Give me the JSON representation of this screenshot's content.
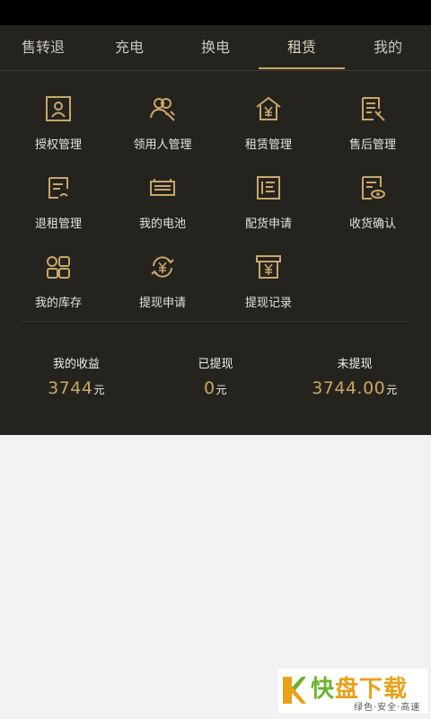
{
  "tabs": [
    {
      "label": "售转退",
      "active": false
    },
    {
      "label": "充电",
      "active": false
    },
    {
      "label": "换电",
      "active": false
    },
    {
      "label": "租赁",
      "active": true
    },
    {
      "label": "我的",
      "active": false
    }
  ],
  "menu": [
    {
      "label": "授权管理",
      "icon": "portrait-frame-icon"
    },
    {
      "label": "领用人管理",
      "icon": "users-wrench-icon"
    },
    {
      "label": "租赁管理",
      "icon": "house-yen-icon"
    },
    {
      "label": "售后管理",
      "icon": "document-wrench-icon"
    },
    {
      "label": "退租管理",
      "icon": "note-pen-icon"
    },
    {
      "label": "我的电池",
      "icon": "battery-icon"
    },
    {
      "label": "配货申请",
      "icon": "document-list-icon"
    },
    {
      "label": "收货确认",
      "icon": "document-eye-icon"
    },
    {
      "label": "我的库存",
      "icon": "inventory-icon"
    },
    {
      "label": "提现申请",
      "icon": "yen-cycle-icon"
    },
    {
      "label": "提现记录",
      "icon": "yen-box-icon"
    }
  ],
  "stats": [
    {
      "title": "我的收益",
      "value": "3744",
      "unit": "元"
    },
    {
      "title": "已提现",
      "value": "0",
      "unit": "元"
    },
    {
      "title": "未提现",
      "value": "3744.00",
      "unit": "元"
    }
  ],
  "watermark": {
    "title_a": "快",
    "title_b": "盘下载",
    "subtitle": "绿色·安全·高速"
  },
  "colors": {
    "panel": "#25231e",
    "accent": "#c7a76a",
    "text": "#e6e3dc"
  }
}
